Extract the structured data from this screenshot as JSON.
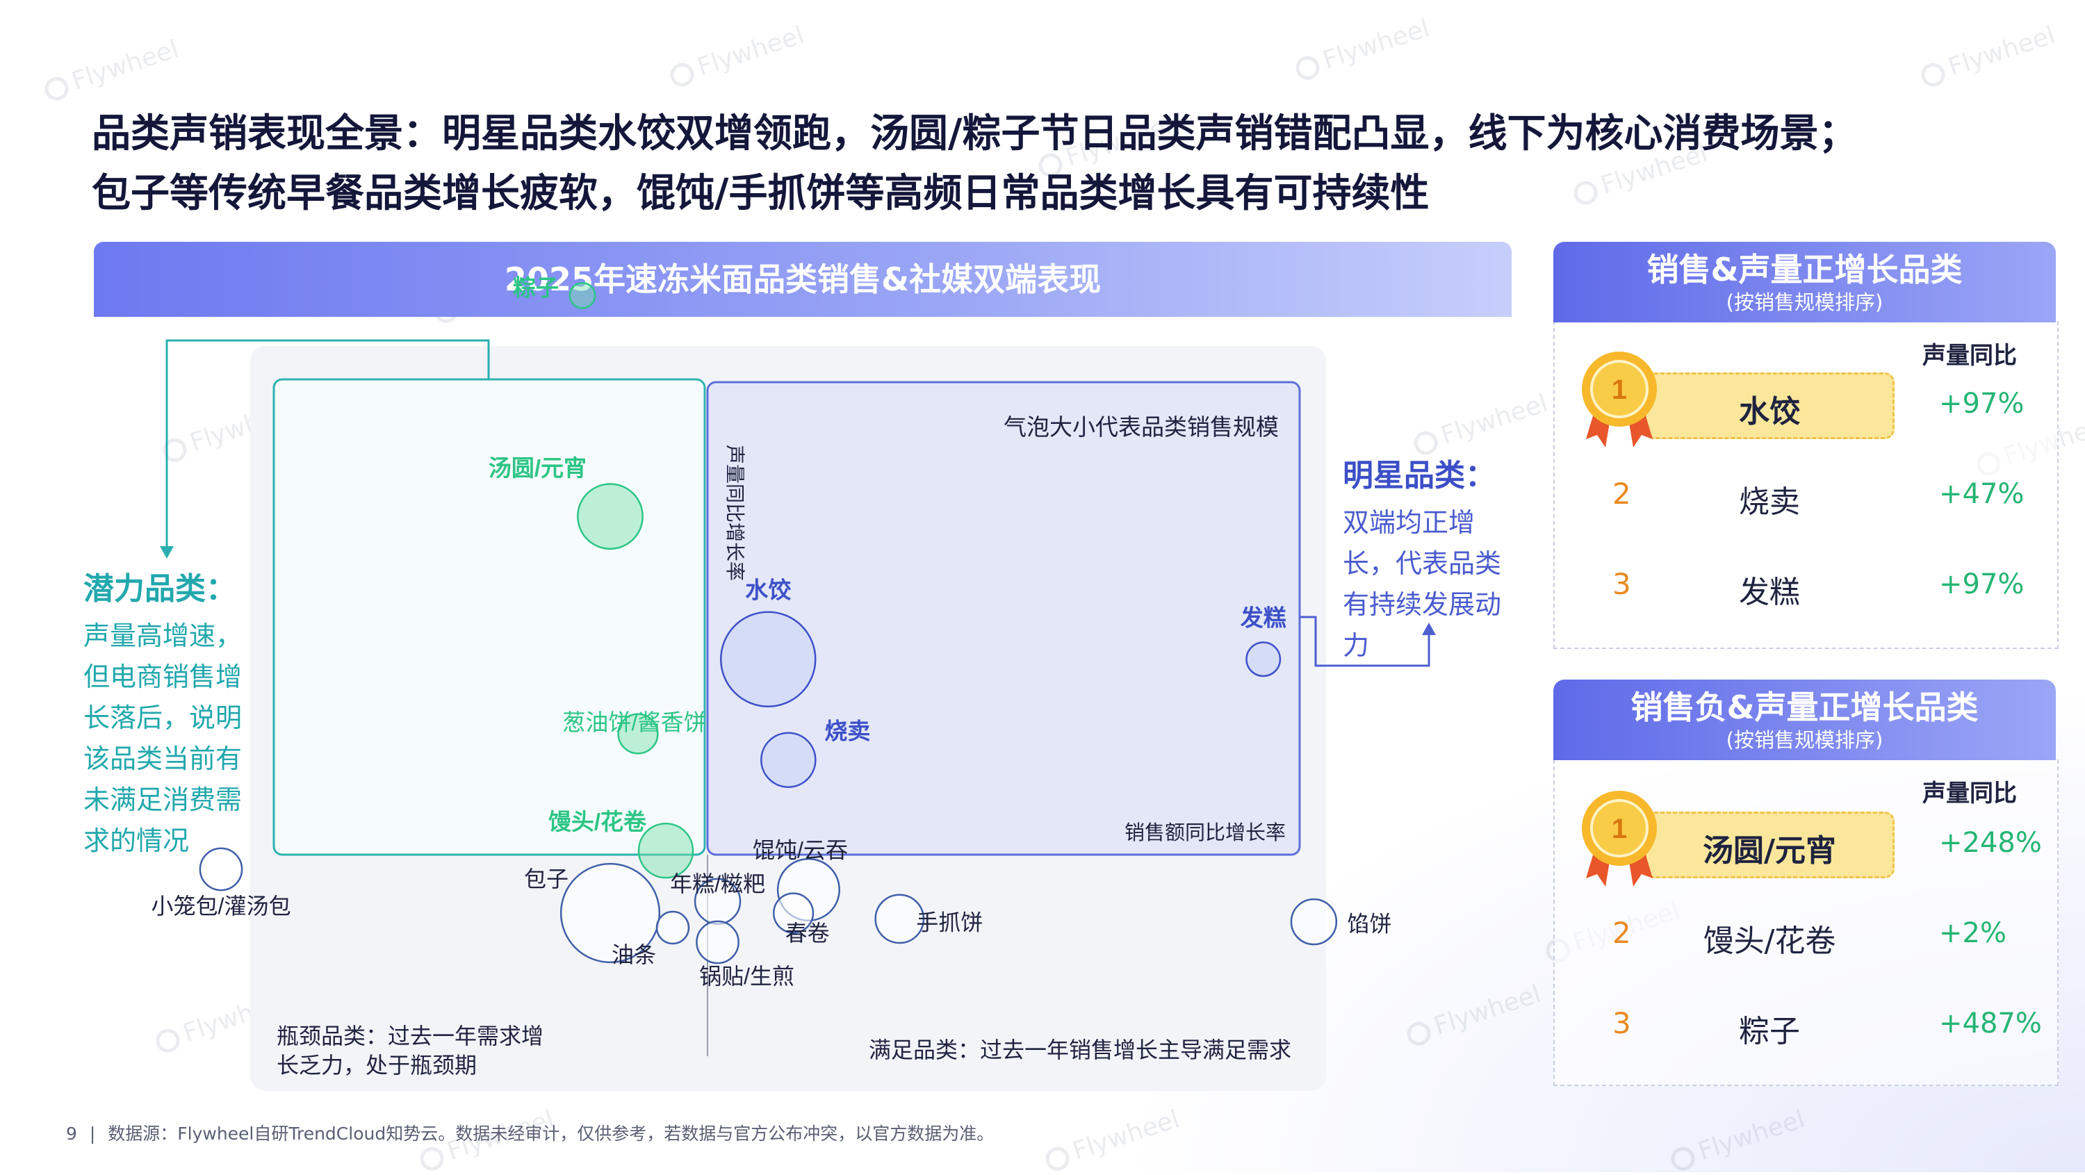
{
  "title_line1": "品类声销表现全景：明星品类水饺双增领跑，汤圆/粽子节日品类声销错配凸显，线下为核心消费场景；",
  "title_line2": "包子等传统早餐品类增长疲软，馄饨/手抓饼等高频日常品类增长具有可持续性",
  "watermark": "Flywheel",
  "chart_header": "2025年速冻米面品类销售&社媒双端表现",
  "chart_data": {
    "type": "scatter",
    "title": "2025年速冻米面品类销售&社媒双端表现",
    "xlabel": "销售额同比增长率",
    "ylabel": "声量同比增长率",
    "note": "气泡大小代表品类销售规模",
    "quadrants": {
      "potential_title": "潜力品类：",
      "potential_desc": "声量高增速，但电商销售增长落后，说明该品类当前有未满足消费需求的情况",
      "star_title": "明星品类：",
      "star_desc": "双端均正增长，代表品类有持续发展动力",
      "bottleneck": "瓶颈品类：过去一年需求增长乏力，处于瓶颈期",
      "satisfied": "满足品类：过去一年销售增长主导满足需求"
    },
    "points": [
      {
        "name": "粽子",
        "x": -0.18,
        "y": 4.87,
        "size": 2,
        "group": "potential"
      },
      {
        "name": "汤圆/元宵",
        "x": -0.14,
        "y": 2.48,
        "size": 40,
        "group": "potential"
      },
      {
        "name": "葱油饼/酱香饼",
        "x": -0.1,
        "y": 0.6,
        "size": 10,
        "group": "potential"
      },
      {
        "name": "馒头/花卷",
        "x": -0.06,
        "y": 0.02,
        "size": 25,
        "group": "potential"
      },
      {
        "name": "水饺",
        "x": 0.12,
        "y": 0.97,
        "size": 100,
        "group": "star"
      },
      {
        "name": "烧卖",
        "x": 0.16,
        "y": 0.47,
        "size": 25,
        "group": "star"
      },
      {
        "name": "发糕",
        "x": 1.1,
        "y": 0.97,
        "size": 6,
        "group": "star"
      },
      {
        "name": "小笼包/灌汤包",
        "x": -0.7,
        "y": -0.05,
        "size": 12,
        "group": "other"
      },
      {
        "name": "包子",
        "x": -0.14,
        "y": -0.2,
        "size": 110,
        "group": "other"
      },
      {
        "name": "油条",
        "x": -0.05,
        "y": -0.25,
        "size": 5,
        "group": "other"
      },
      {
        "name": "年糕/糍粑",
        "x": 0.02,
        "y": -0.16,
        "size": 15,
        "group": "other"
      },
      {
        "name": "锅贴/生煎",
        "x": 0.02,
        "y": -0.3,
        "size": 12,
        "group": "other"
      },
      {
        "name": "馄饨/云吞",
        "x": 0.2,
        "y": -0.12,
        "size": 35,
        "group": "other"
      },
      {
        "name": "春卷",
        "x": 0.17,
        "y": -0.2,
        "size": 10,
        "group": "other"
      },
      {
        "name": "手抓饼",
        "x": 0.38,
        "y": -0.22,
        "size": 18,
        "group": "other"
      },
      {
        "name": "馅饼",
        "x": 1.2,
        "y": -0.23,
        "size": 15,
        "group": "other"
      }
    ],
    "colors": {
      "potential": "#2cc585",
      "star": "#3c50c8",
      "other": "#3f5fa8"
    }
  },
  "panel1": {
    "title": "销售&声量正增长品类",
    "subtitle": "(按销售规模排序)",
    "col_label": "声量同比",
    "rows": [
      {
        "rank": "1",
        "name": "水饺",
        "value": "+97%"
      },
      {
        "rank": "2",
        "name": "烧卖",
        "value": "+47%"
      },
      {
        "rank": "3",
        "name": "发糕",
        "value": "+97%"
      }
    ]
  },
  "panel2": {
    "title": "销售负&声量正增长品类",
    "subtitle": "(按销售规模排序)",
    "col_label": "声量同比",
    "rows": [
      {
        "rank": "1",
        "name": "汤圆/元宵",
        "value": "+248%"
      },
      {
        "rank": "2",
        "name": "馒头/花卷",
        "value": "+2%"
      },
      {
        "rank": "3",
        "name": "粽子",
        "value": "+487%"
      }
    ]
  },
  "footer": {
    "page": "9",
    "source": "数据源：Flywheel自研TrendCloud知势云。数据未经审计，仅供参考，若数据与官方公布冲突，以官方数据为准。"
  }
}
